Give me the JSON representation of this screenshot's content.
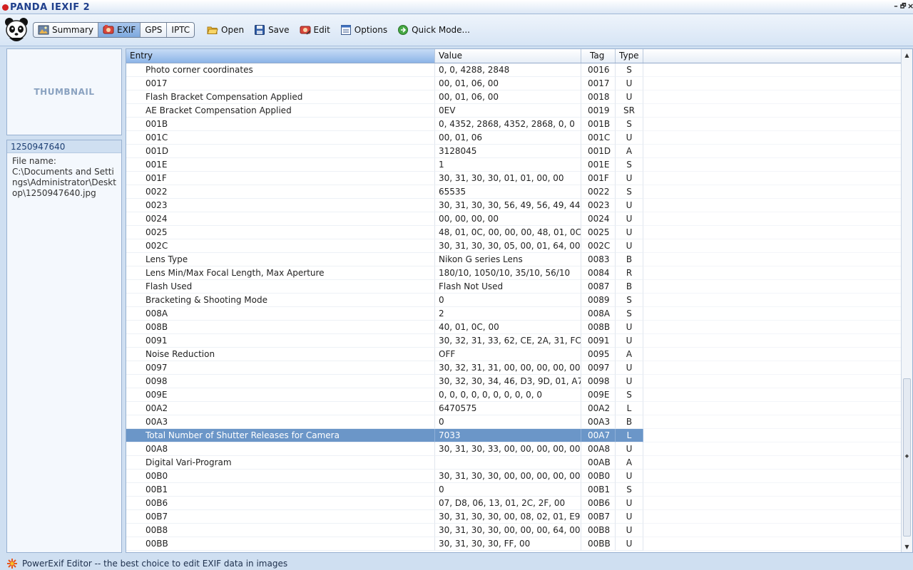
{
  "window": {
    "title": "PANDA IEXIF 2",
    "controls": [
      "–",
      "🗗",
      "×"
    ]
  },
  "toolbar": {
    "tabs": [
      {
        "label": "Summary",
        "icon": "summary-icon",
        "active": false
      },
      {
        "label": "EXIF",
        "icon": "exif-icon",
        "active": true
      },
      {
        "label": "GPS",
        "icon": "",
        "active": false
      },
      {
        "label": "IPTC",
        "icon": "",
        "active": false
      }
    ],
    "actions": [
      {
        "label": "Open",
        "icon": "folder-open-icon"
      },
      {
        "label": "Save",
        "icon": "floppy-disk-icon"
      },
      {
        "label": "Edit",
        "icon": "edit-icon"
      },
      {
        "label": "Options",
        "icon": "options-icon"
      },
      {
        "label": "Quick Mode...",
        "icon": "quick-mode-icon"
      }
    ]
  },
  "left_panel": {
    "thumbnail_label": "THUMBNAIL",
    "file_id": "1250947640",
    "file_name_label": "File name:",
    "file_path": "C:\\Documents and Settings\\Administrator\\Desktop\\1250947640.jpg"
  },
  "table": {
    "columns": [
      "Entry",
      "Value",
      "Tag",
      "Type"
    ],
    "selected_index": 27,
    "rows": [
      {
        "entry": "Photo corner coordinates",
        "value": "0, 0, 4288, 2848",
        "tag": "0016",
        "type": "S"
      },
      {
        "entry": "0017",
        "value": "00, 01, 06, 00",
        "tag": "0017",
        "type": "U"
      },
      {
        "entry": "Flash Bracket Compensation Applied",
        "value": "00, 01, 06, 00",
        "tag": "0018",
        "type": "U"
      },
      {
        "entry": "AE Bracket Compensation Applied",
        "value": "0EV",
        "tag": "0019",
        "type": "SR"
      },
      {
        "entry": "001B",
        "value": "0, 4352, 2868, 4352, 2868, 0, 0",
        "tag": "001B",
        "type": "S"
      },
      {
        "entry": "001C",
        "value": "00, 01, 06",
        "tag": "001C",
        "type": "U"
      },
      {
        "entry": "001D",
        "value": "3128045",
        "tag": "001D",
        "type": "A"
      },
      {
        "entry": "001E",
        "value": "1",
        "tag": "001E",
        "type": "S"
      },
      {
        "entry": "001F",
        "value": "30, 31, 30, 30, 01, 01, 00, 00",
        "tag": "001F",
        "type": "U"
      },
      {
        "entry": "0022",
        "value": "65535",
        "tag": "0022",
        "type": "S"
      },
      {
        "entry": "0023",
        "value": "30, 31, 30, 30, 56, 49, 56, 49, 44, ...",
        "tag": "0023",
        "type": "U"
      },
      {
        "entry": "0024",
        "value": "00, 00, 00, 00",
        "tag": "0024",
        "type": "U"
      },
      {
        "entry": "0025",
        "value": "48, 01, 0C, 00, 00, 00, 48, 01, 0C, ...",
        "tag": "0025",
        "type": "U"
      },
      {
        "entry": "002C",
        "value": "30, 31, 30, 30, 05, 00, 01, 64, 00, ...",
        "tag": "002C",
        "type": "U"
      },
      {
        "entry": "Lens Type",
        "value": "Nikon G series Lens",
        "tag": "0083",
        "type": "B"
      },
      {
        "entry": "Lens Min/Max Focal Length, Max Aperture",
        "value": "180/10, 1050/10, 35/10, 56/10",
        "tag": "0084",
        "type": "R"
      },
      {
        "entry": "Flash Used",
        "value": "Flash Not Used",
        "tag": "0087",
        "type": "B"
      },
      {
        "entry": "Bracketing & Shooting Mode",
        "value": "0",
        "tag": "0089",
        "type": "S"
      },
      {
        "entry": "008A",
        "value": "2",
        "tag": "008A",
        "type": "S"
      },
      {
        "entry": "008B",
        "value": "40, 01, 0C, 00",
        "tag": "008B",
        "type": "U"
      },
      {
        "entry": "0091",
        "value": "30, 32, 31, 33, 62, CE, 2A, 31, FC,...",
        "tag": "0091",
        "type": "U"
      },
      {
        "entry": "Noise Reduction",
        "value": "OFF",
        "tag": "0095",
        "type": "A"
      },
      {
        "entry": "0097",
        "value": "30, 32, 31, 31, 00, 00, 00, 00, 00, ...",
        "tag": "0097",
        "type": "U"
      },
      {
        "entry": "0098",
        "value": "30, 32, 30, 34, 46, D3, 9D, 01, A7, ...",
        "tag": "0098",
        "type": "U"
      },
      {
        "entry": "009E",
        "value": "0, 0, 0, 0, 0, 0, 0, 0, 0, 0",
        "tag": "009E",
        "type": "S"
      },
      {
        "entry": "00A2",
        "value": "6470575",
        "tag": "00A2",
        "type": "L"
      },
      {
        "entry": "00A3",
        "value": "0",
        "tag": "00A3",
        "type": "B"
      },
      {
        "entry": "Total Number of Shutter Releases for Camera",
        "value": "7033",
        "tag": "00A7",
        "type": "L"
      },
      {
        "entry": "00A8",
        "value": "30, 31, 30, 33, 00, 00, 00, 00, 00, ...",
        "tag": "00A8",
        "type": "U"
      },
      {
        "entry": "Digital Vari-Program",
        "value": "",
        "tag": "00AB",
        "type": "A"
      },
      {
        "entry": "00B0",
        "value": "30, 31, 30, 30, 00, 00, 00, 00, 00, ...",
        "tag": "00B0",
        "type": "U"
      },
      {
        "entry": "00B1",
        "value": "0",
        "tag": "00B1",
        "type": "S"
      },
      {
        "entry": "00B6",
        "value": "07, D8, 06, 13, 01, 2C, 2F, 00",
        "tag": "00B6",
        "type": "U"
      },
      {
        "entry": "00B7",
        "value": "30, 31, 30, 30, 00, 08, 02, 01, E9, ...",
        "tag": "00B7",
        "type": "U"
      },
      {
        "entry": "00B8",
        "value": "30, 31, 30, 30, 00, 00, 00, 64, 00, ...",
        "tag": "00B8",
        "type": "U"
      },
      {
        "entry": "00BB",
        "value": "30, 31, 30, 30, FF, 00",
        "tag": "00BB",
        "type": "U"
      }
    ]
  },
  "statusbar": {
    "text": "PowerExif Editor -- the best choice to edit EXIF data in images"
  },
  "colors": {
    "selection": "#6b96c8",
    "title": "#1f3f8c",
    "panel_bg": "#cfdff1"
  }
}
